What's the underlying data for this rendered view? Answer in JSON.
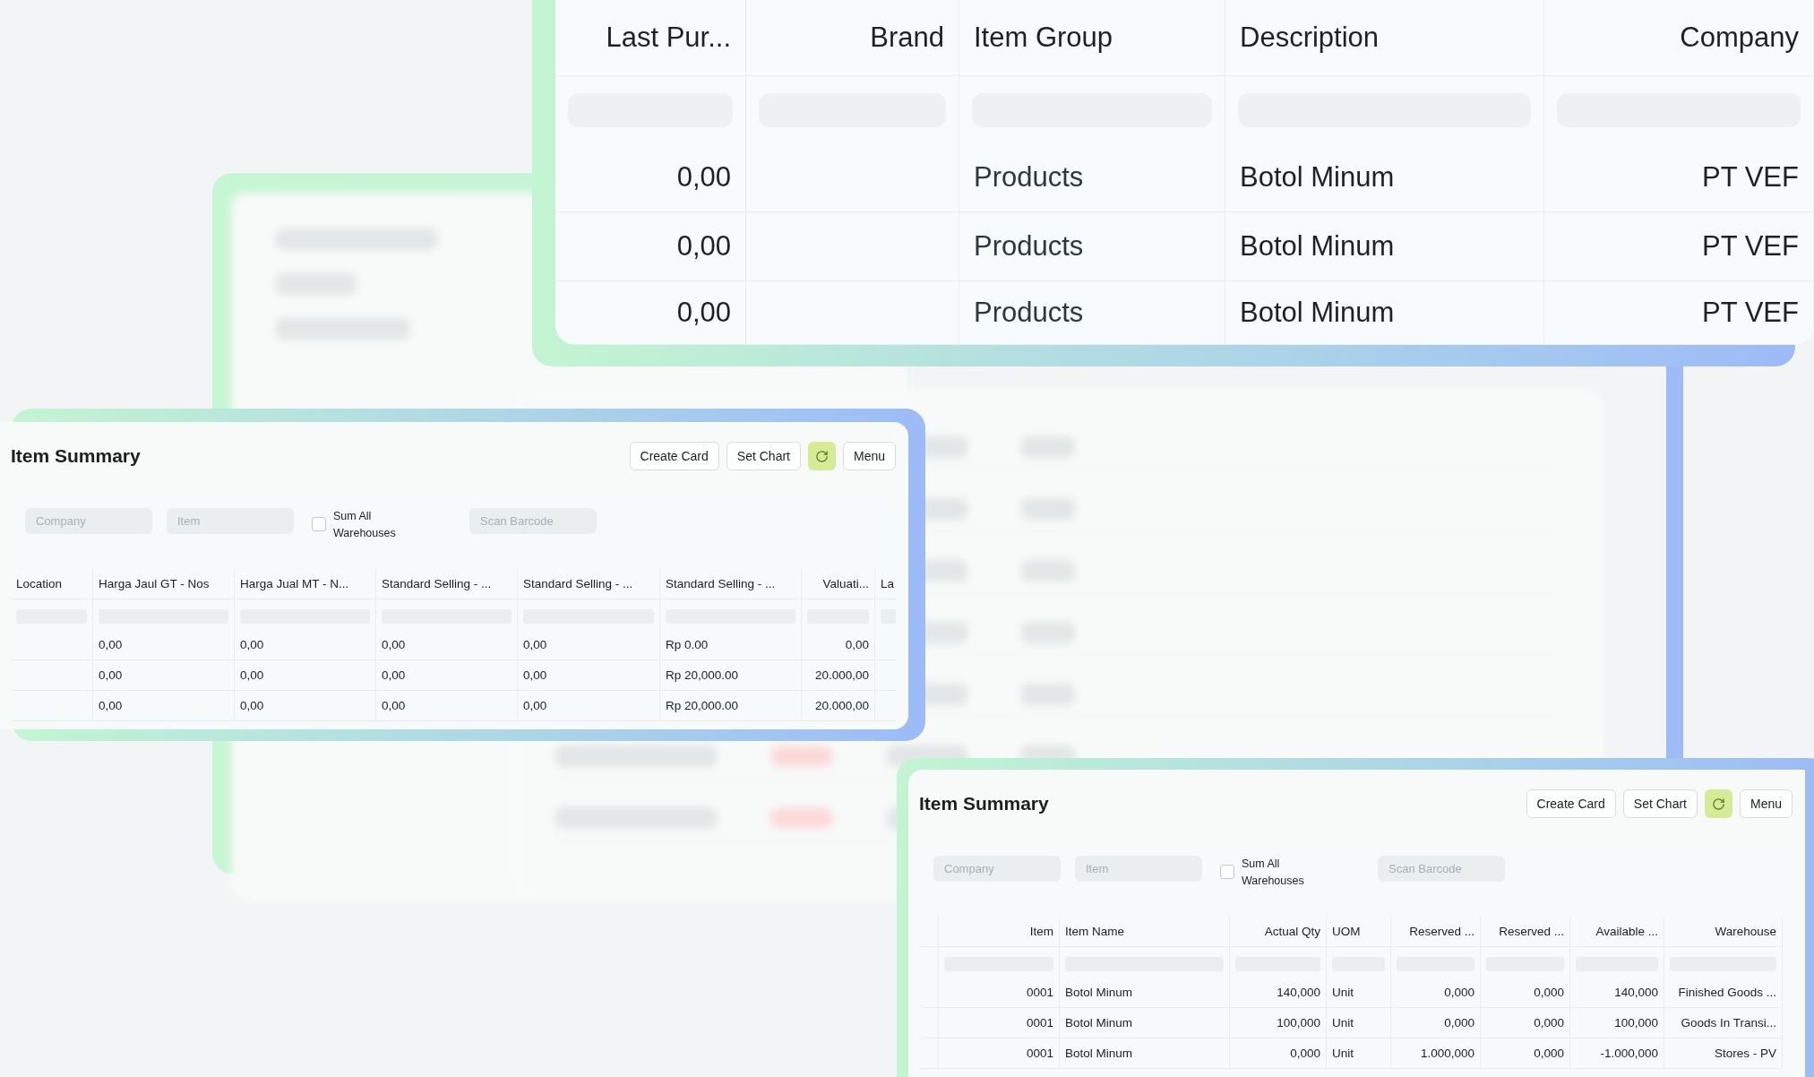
{
  "top_table": {
    "columns": [
      {
        "label": "Last Pur..."
      },
      {
        "label": "Brand"
      },
      {
        "label": "Item Group"
      },
      {
        "label": "Description"
      },
      {
        "label": "Company"
      }
    ],
    "rows": [
      [
        "0,00",
        null,
        "Products",
        "Botol Minum",
        "PT VEF"
      ],
      [
        "0,00",
        null,
        "Products",
        "Botol Minum",
        "PT VEF"
      ],
      [
        "0,00",
        null,
        "Products",
        "Botol Minum",
        "PT VEF"
      ]
    ]
  },
  "item_summary_panels": [
    {
      "title": "Item Summary",
      "buttons": [
        "Create Card",
        "Set Chart"
      ],
      "menu": "Menu",
      "filters": {
        "company_placeholder": "Company",
        "item_placeholder": "Item",
        "sum_all_warehouses": {
          "label": "Sum All Warehouses",
          "checked": false
        },
        "barcode_placeholder": "Scan Barcode"
      },
      "columns": [
        {
          "label": "Location"
        },
        {
          "label": "Harga Jaul GT - Nos"
        },
        {
          "label": "Harga Jual MT - N..."
        },
        {
          "label": "Standard Selling - ..."
        },
        {
          "label": "Standard Selling - ..."
        },
        {
          "label": "Standard Selling - ..."
        },
        {
          "label": "Valuati..."
        },
        {
          "label": "La"
        }
      ],
      "rows": [
        [
          null,
          "0,00",
          "0,00",
          "0,00",
          "0,00",
          "Rp 0.00",
          "0,00",
          null
        ],
        [
          null,
          "0,00",
          "0,00",
          "0,00",
          "0,00",
          "Rp 20,000.00",
          "20.000,00",
          null
        ],
        [
          null,
          "0,00",
          "0,00",
          "0,00",
          "0,00",
          "Rp 20,000.00",
          "20.000,00",
          null
        ]
      ]
    },
    {
      "title": "Item Summary",
      "buttons": [
        "Create Card",
        "Set Chart"
      ],
      "menu": "Menu",
      "filters": {
        "company_placeholder": "Company",
        "item_placeholder": "Item",
        "sum_all_warehouses": {
          "label": "Sum All Warehouses",
          "checked": false
        },
        "barcode_placeholder": "Scan Barcode"
      },
      "columns": [
        {
          "label": "Item"
        },
        {
          "label": "Item Name"
        },
        {
          "label": "Actual Qty"
        },
        {
          "label": "UOM"
        },
        {
          "label": "Reserved ..."
        },
        {
          "label": "Reserved ..."
        },
        {
          "label": "Available ..."
        },
        {
          "label": "Warehouse"
        }
      ],
      "rows": [
        [
          "0001",
          "Botol Minum",
          "140,000",
          "Unit",
          "0,000",
          "0,000",
          "140,000",
          "Finished Goods ..."
        ],
        [
          "0001",
          "Botol Minum",
          "100,000",
          "Unit",
          "0,000",
          "0,000",
          "100,000",
          "Goods In Transi..."
        ],
        [
          "0001",
          "Botol Minum",
          "0,000",
          "Unit",
          "1.000,000",
          "0,000",
          "-1.000,000",
          "Stores - PV"
        ]
      ]
    }
  ]
}
